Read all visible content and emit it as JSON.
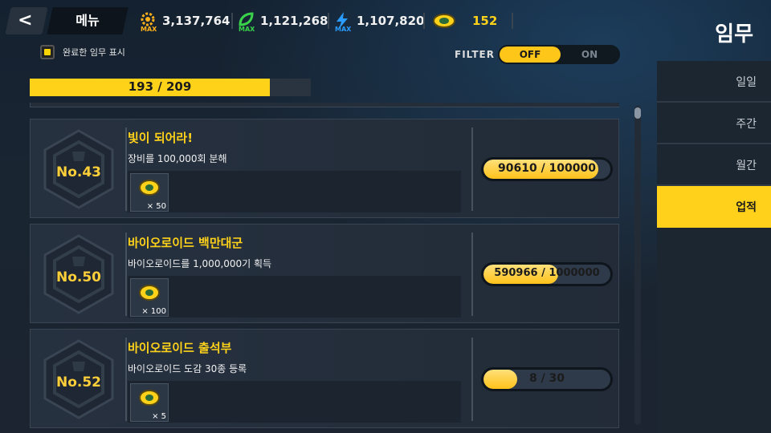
{
  "header": {
    "back_label": "<",
    "menu_label": "메뉴",
    "page_title": "임무",
    "resources": [
      {
        "icon": "gear-max-icon",
        "value": "3,137,764",
        "color": "#ffb11a",
        "badge": "MAX"
      },
      {
        "icon": "leaf-max-icon",
        "value": "1,121,268",
        "color": "#3ad24a",
        "badge": "MAX"
      },
      {
        "icon": "energy-max-icon",
        "value": "1,107,820",
        "color": "#2a9cff",
        "badge": "MAX"
      },
      {
        "icon": "bio-coin-icon",
        "value": "152",
        "color": "#ffd21a"
      }
    ]
  },
  "filters": {
    "show_completed_label": "완료한 임무 표시",
    "filter_label": "FILTER",
    "off_label": "OFF",
    "on_label": "ON",
    "selected": "OFF"
  },
  "overall_progress": {
    "text": "193 / 209",
    "current": 193,
    "total": 209
  },
  "missions": [
    {
      "number": "No.43",
      "title": "빛이 되어라!",
      "desc": "장비를 100,000회 분해",
      "reward_icon": "bio-coin-icon",
      "reward_qty": "× 50",
      "progress_text": "90610 / 100000",
      "current": 90610,
      "target": 100000
    },
    {
      "number": "No.50",
      "title": "바이오로이드 백만대군",
      "desc": "바이오로이드를 1,000,000기 획득",
      "reward_icon": "bio-coin-icon",
      "reward_qty": "× 100",
      "progress_text": "590966 / 1000000",
      "current": 590966,
      "target": 1000000
    },
    {
      "number": "No.52",
      "title": "바이오로이드 출석부",
      "desc": "바이오로이드 도감 30종 등록",
      "reward_icon": "bio-coin-icon",
      "reward_qty": "× 5",
      "progress_text": "8 / 30",
      "current": 8,
      "target": 30
    }
  ],
  "tabs": [
    {
      "label": "일일",
      "active": false
    },
    {
      "label": "주간",
      "active": false
    },
    {
      "label": "월간",
      "active": false
    },
    {
      "label": "업적",
      "active": true
    }
  ],
  "colors": {
    "accent": "#ffd21a",
    "badge_text": "#ffcf3a"
  }
}
